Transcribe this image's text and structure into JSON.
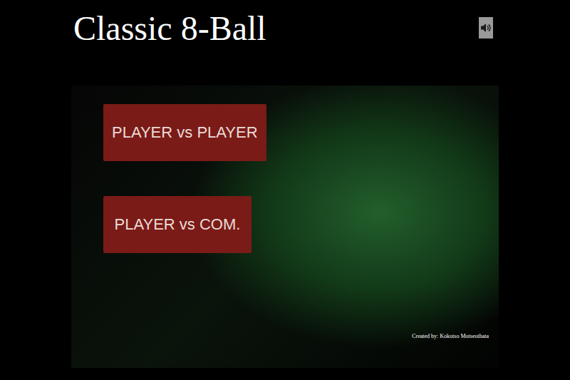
{
  "window": {
    "title": "Classic 8-Ball"
  },
  "sound": {
    "muted": false
  },
  "menu": [
    {
      "label": "PLAYER vs PLAYER"
    },
    {
      "label": "PLAYER vs COM."
    }
  ],
  "credit": "Created by: Kokotso Motseothata"
}
